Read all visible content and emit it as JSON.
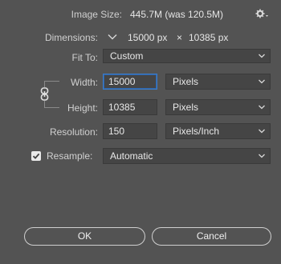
{
  "image_size": {
    "label": "Image Size:",
    "value": "445.7M (was 120.5M)"
  },
  "dimensions": {
    "label": "Dimensions:",
    "width": "15000 px",
    "times": "×",
    "height": "10385 px"
  },
  "fit_to": {
    "label": "Fit To:",
    "value": "Custom"
  },
  "width": {
    "label": "Width:",
    "value": "15000",
    "unit": "Pixels"
  },
  "height": {
    "label": "Height:",
    "value": "10385",
    "unit": "Pixels"
  },
  "resolution": {
    "label": "Resolution:",
    "value": "150",
    "unit": "Pixels/Inch"
  },
  "resample": {
    "label": "Resample:",
    "checked": true,
    "method": "Automatic"
  },
  "buttons": {
    "ok": "OK",
    "cancel": "Cancel"
  },
  "colors": {
    "background": "#535353",
    "field": "#454545",
    "focus": "#3d7dca"
  }
}
